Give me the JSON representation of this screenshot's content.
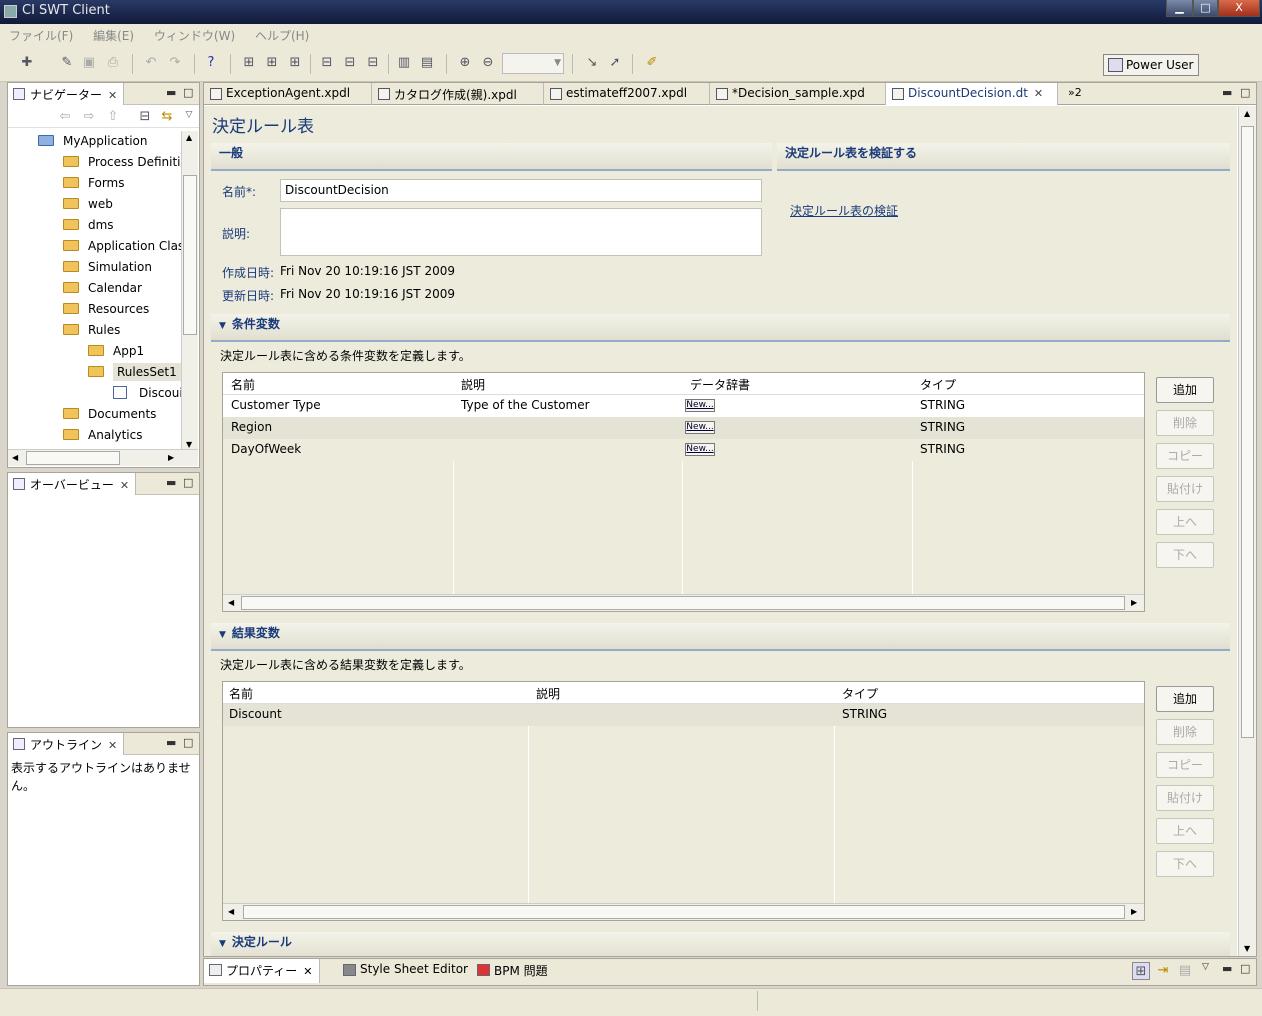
{
  "window": {
    "title": "CI SWT Client",
    "min": "▁",
    "max": "□",
    "close": "X"
  },
  "menu": [
    "ファイル(F)",
    "編集(E)",
    "ウィンドウ(W)",
    "ヘルプ(H)"
  ],
  "toolbar": {
    "power_user": "Power User"
  },
  "navigator": {
    "tab": "ナビゲーター",
    "items": [
      {
        "label": "MyApplication",
        "indent": 0,
        "type": "project"
      },
      {
        "label": "Process Definiti",
        "indent": 1,
        "type": "folder"
      },
      {
        "label": "Forms",
        "indent": 1,
        "type": "folder"
      },
      {
        "label": "web",
        "indent": 1,
        "type": "folder"
      },
      {
        "label": "dms",
        "indent": 1,
        "type": "folder"
      },
      {
        "label": "Application Clas",
        "indent": 1,
        "type": "folder"
      },
      {
        "label": "Simulation",
        "indent": 1,
        "type": "folder"
      },
      {
        "label": "Calendar",
        "indent": 1,
        "type": "folder"
      },
      {
        "label": "Resources",
        "indent": 1,
        "type": "folder"
      },
      {
        "label": "Rules",
        "indent": 1,
        "type": "folder"
      },
      {
        "label": "App1",
        "indent": 2,
        "type": "folder"
      },
      {
        "label": "RulesSet1",
        "indent": 2,
        "type": "folder",
        "selected": true
      },
      {
        "label": "Discoui",
        "indent": 3,
        "type": "file"
      },
      {
        "label": "Documents",
        "indent": 1,
        "type": "folder"
      },
      {
        "label": "Analytics",
        "indent": 1,
        "type": "folder"
      }
    ]
  },
  "overview": {
    "tab": "オーバービュー"
  },
  "outline": {
    "tab": "アウトライン",
    "message": "表示するアウトラインはありません。"
  },
  "editor_tabs": [
    {
      "label": "ExceptionAgent.xpdl",
      "active": false
    },
    {
      "label": "カタログ作成(親).xpdl",
      "active": false
    },
    {
      "label": "estimateff2007.xpdl",
      "active": false
    },
    {
      "label": "*Decision_sample.xpd",
      "active": false
    },
    {
      "label": "DiscountDecision.dt",
      "active": true
    }
  ],
  "editor_overflow": "»2",
  "form": {
    "title": "決定ルール表",
    "general": {
      "header": "一般",
      "name_label": "名前*:",
      "name_value": "DiscountDecision",
      "desc_label": "説明:",
      "created_label": "作成日時:",
      "created_value": "Fri Nov 20 10:19:16 JST 2009",
      "updated_label": "更新日時:",
      "updated_value": "Fri Nov 20 10:19:16 JST 2009"
    },
    "validate": {
      "header": "決定ルール表を検証する",
      "link": "決定ルール表の検証"
    },
    "conditions": {
      "header": "条件変数",
      "desc": "決定ルール表に含める条件変数を定義します。",
      "columns": [
        "名前",
        "説明",
        "データ辞書",
        "タイプ"
      ],
      "rows": [
        {
          "name": "Customer Type",
          "desc": "Type of the Customer",
          "dict": "New...",
          "type": "STRING"
        },
        {
          "name": "Region",
          "desc": "",
          "dict": "New...",
          "type": "STRING"
        },
        {
          "name": "DayOfWeek",
          "desc": "",
          "dict": "New...",
          "type": "STRING"
        }
      ]
    },
    "results": {
      "header": "結果変数",
      "desc": "決定ルール表に含める結果変数を定義します。",
      "columns": [
        "名前",
        "説明",
        "タイプ"
      ],
      "rows": [
        {
          "name": "Discount",
          "desc": "",
          "type": "STRING"
        }
      ]
    },
    "buttons": {
      "add": "追加",
      "delete": "削除",
      "copy": "コピー",
      "paste": "貼付け",
      "up": "上へ",
      "down": "下へ"
    },
    "rules": {
      "header": "決定ルール"
    }
  },
  "bottom_tabs": [
    "プロパティー",
    "Style Sheet Editor",
    "BPM 問題"
  ]
}
